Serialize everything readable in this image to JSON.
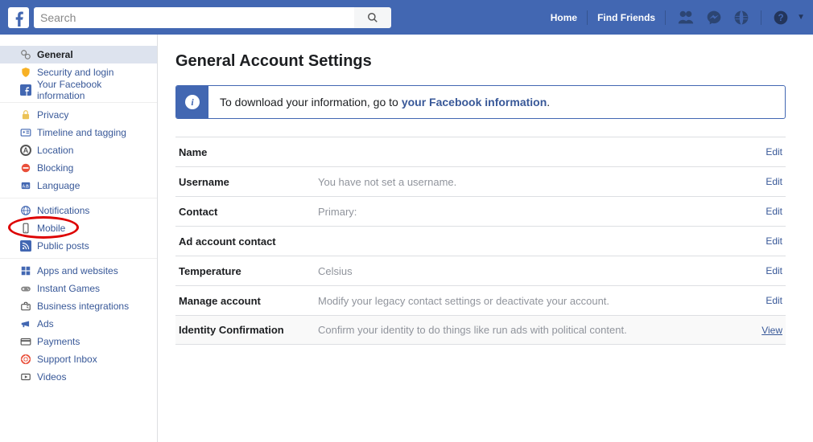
{
  "topbar": {
    "search_placeholder": "Search",
    "home": "Home",
    "find_friends": "Find Friends"
  },
  "sidebar": {
    "groups": [
      {
        "items": [
          {
            "label": "General",
            "icon": "gears-icon",
            "active": true
          },
          {
            "label": "Security and login",
            "icon": "shield-icon"
          },
          {
            "label": "Your Facebook information",
            "icon": "fb-square-icon"
          }
        ]
      },
      {
        "items": [
          {
            "label": "Privacy",
            "icon": "lock-icon"
          },
          {
            "label": "Timeline and tagging",
            "icon": "id-card-icon"
          },
          {
            "label": "Location",
            "icon": "letter-a-icon"
          },
          {
            "label": "Blocking",
            "icon": "blocking-icon"
          },
          {
            "label": "Language",
            "icon": "language-icon"
          }
        ]
      },
      {
        "items": [
          {
            "label": "Notifications",
            "icon": "globe-icon"
          },
          {
            "label": "Mobile",
            "icon": "mobile-icon",
            "highlight": true
          },
          {
            "label": "Public posts",
            "icon": "rss-icon"
          }
        ]
      },
      {
        "items": [
          {
            "label": "Apps and websites",
            "icon": "apps-icon"
          },
          {
            "label": "Instant Games",
            "icon": "gamepad-icon"
          },
          {
            "label": "Business integrations",
            "icon": "briefcase-icon"
          },
          {
            "label": "Ads",
            "icon": "megaphone-icon"
          },
          {
            "label": "Payments",
            "icon": "card-icon"
          },
          {
            "label": "Support Inbox",
            "icon": "lifebuoy-icon"
          },
          {
            "label": "Videos",
            "icon": "video-icon"
          }
        ]
      }
    ]
  },
  "main": {
    "title": "General Account Settings",
    "info_prefix": "To download your information, go to ",
    "info_link": "your Facebook information",
    "rows": [
      {
        "label": "Name",
        "value": "",
        "action": "Edit"
      },
      {
        "label": "Username",
        "value": "You have not set a username.",
        "action": "Edit"
      },
      {
        "label": "Contact",
        "value": "Primary:",
        "action": "Edit"
      },
      {
        "label": "Ad account contact",
        "value": "",
        "action": "Edit"
      },
      {
        "label": "Temperature",
        "value": "Celsius",
        "action": "Edit"
      },
      {
        "label": "Manage account",
        "value": "Modify your legacy contact settings or deactivate your account.",
        "action": "Edit"
      },
      {
        "label": "Identity Confirmation",
        "value": "Confirm your identity to do things like run ads with political content.",
        "action": "View"
      }
    ]
  },
  "icons": {
    "gears-icon": "#7a7a7a",
    "shield-icon": "#f7b125",
    "fb-square-icon": "#4267b2",
    "lock-icon": "#ecc255",
    "id-card-icon": "#4267b2",
    "letter-a-icon": "#555",
    "blocking-icon": "#e94f3a",
    "language-icon": "#4267b2",
    "globe-icon": "#4267b2",
    "mobile-icon": "#555",
    "rss-icon": "#4267b2",
    "apps-icon": "#4267b2",
    "gamepad-icon": "#888",
    "briefcase-icon": "#555",
    "megaphone-icon": "#4267b2",
    "card-icon": "#555",
    "lifebuoy-icon": "#e94f3a",
    "video-icon": "#555"
  }
}
